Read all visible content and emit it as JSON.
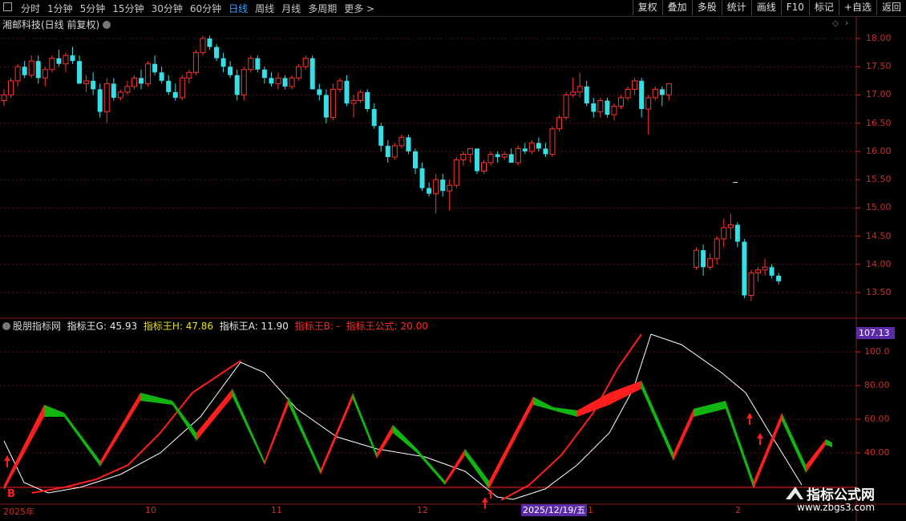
{
  "toolbar": {
    "periods": [
      "分时",
      "1分钟",
      "5分钟",
      "15分钟",
      "30分钟",
      "60分钟",
      "日线",
      "周线",
      "月线",
      "多周期",
      "更多 >"
    ],
    "active_period": "日线",
    "buttons": [
      "复权",
      "叠加",
      "多股",
      "统计",
      "画线",
      "F10",
      "标记",
      "+自选",
      "返回"
    ]
  },
  "stock": {
    "title": "湘邮科技(日线 前复权)"
  },
  "price_axis": [
    "18.00",
    "17.50",
    "17.00",
    "16.50",
    "16.00",
    "15.50",
    "15.00",
    "14.50",
    "14.00",
    "13.50"
  ],
  "indicator": {
    "name": "股朋指标网",
    "g": "指标王G: 45.93",
    "h": "指标王H: 47.86",
    "a": "指标王A: 11.90",
    "b": "指标王B: -",
    "formula": "指标王公式: 20.00",
    "badge": "107.13",
    "axis": [
      "100.0",
      "80.00",
      "60.00",
      "40.00"
    ]
  },
  "dates": [
    "2025年",
    "10",
    "11",
    "12",
    "2025/12/19/五",
    "1",
    "2"
  ],
  "marks": {
    "b": "B"
  },
  "watermark": {
    "line1": "指标公式网",
    "line2": "www.zbgs3.com"
  },
  "colors": {
    "up": "#ff3232",
    "down": "#34e0e6",
    "green": "#11b411",
    "red": "#ff1e1e",
    "white": "#ffffff"
  },
  "chart_data": {
    "type": "candlestick",
    "ylim": [
      13.3,
      18.2
    ],
    "candles": [
      [
        16.9,
        17.1,
        16.8,
        17.0
      ],
      [
        17.0,
        17.3,
        16.95,
        17.25
      ],
      [
        17.25,
        17.55,
        17.15,
        17.5
      ],
      [
        17.5,
        17.6,
        17.3,
        17.35
      ],
      [
        17.35,
        17.7,
        17.3,
        17.6
      ],
      [
        17.6,
        17.7,
        17.2,
        17.3
      ],
      [
        17.3,
        17.5,
        17.15,
        17.45
      ],
      [
        17.45,
        17.7,
        17.4,
        17.65
      ],
      [
        17.65,
        17.8,
        17.5,
        17.55
      ],
      [
        17.55,
        17.75,
        17.4,
        17.7
      ],
      [
        17.7,
        17.85,
        17.55,
        17.6
      ],
      [
        17.6,
        17.7,
        17.2,
        17.2
      ],
      [
        17.2,
        17.35,
        17.05,
        17.25
      ],
      [
        17.25,
        17.4,
        17.0,
        17.1
      ],
      [
        17.1,
        17.2,
        16.6,
        16.7
      ],
      [
        16.7,
        17.3,
        16.5,
        17.2
      ],
      [
        17.2,
        17.3,
        16.9,
        16.95
      ],
      [
        16.95,
        17.1,
        16.9,
        17.05
      ],
      [
        17.05,
        17.25,
        17.0,
        17.15
      ],
      [
        17.15,
        17.35,
        17.1,
        17.3
      ],
      [
        17.3,
        17.45,
        17.1,
        17.2
      ],
      [
        17.2,
        17.6,
        17.15,
        17.55
      ],
      [
        17.55,
        17.7,
        17.35,
        17.4
      ],
      [
        17.4,
        17.5,
        17.2,
        17.25
      ],
      [
        17.25,
        17.35,
        17.0,
        17.05
      ],
      [
        17.05,
        17.2,
        16.9,
        16.95
      ],
      [
        16.95,
        17.35,
        16.9,
        17.3
      ],
      [
        17.3,
        17.45,
        17.2,
        17.4
      ],
      [
        17.4,
        17.8,
        17.35,
        17.75
      ],
      [
        17.75,
        18.05,
        17.7,
        18.0
      ],
      [
        18.0,
        18.05,
        17.8,
        17.85
      ],
      [
        17.85,
        17.9,
        17.6,
        17.65
      ],
      [
        17.65,
        17.75,
        17.4,
        17.5
      ],
      [
        17.5,
        17.6,
        17.3,
        17.35
      ],
      [
        17.35,
        17.45,
        16.9,
        17.0
      ],
      [
        17.0,
        17.5,
        16.9,
        17.45
      ],
      [
        17.45,
        17.7,
        17.4,
        17.65
      ],
      [
        17.65,
        17.7,
        17.4,
        17.45
      ],
      [
        17.45,
        17.5,
        17.2,
        17.3
      ],
      [
        17.3,
        17.4,
        17.15,
        17.2
      ],
      [
        17.2,
        17.4,
        17.1,
        17.3
      ],
      [
        17.3,
        17.35,
        17.1,
        17.15
      ],
      [
        17.15,
        17.35,
        17.1,
        17.3
      ],
      [
        17.3,
        17.55,
        17.25,
        17.5
      ],
      [
        17.5,
        17.7,
        17.45,
        17.65
      ],
      [
        17.65,
        17.7,
        17.1,
        17.1
      ],
      [
        17.1,
        17.2,
        16.9,
        17.0
      ],
      [
        17.0,
        17.1,
        16.5,
        16.6
      ],
      [
        16.6,
        17.2,
        16.55,
        17.1
      ],
      [
        17.1,
        17.3,
        17.05,
        17.25
      ],
      [
        17.25,
        17.35,
        16.8,
        16.85
      ],
      [
        16.85,
        17.0,
        16.6,
        16.9
      ],
      [
        16.9,
        17.1,
        16.85,
        17.05
      ],
      [
        17.05,
        17.1,
        16.7,
        16.75
      ],
      [
        16.75,
        16.85,
        16.4,
        16.45
      ],
      [
        16.45,
        16.5,
        16.0,
        16.1
      ],
      [
        16.1,
        16.2,
        15.8,
        15.9
      ],
      [
        15.9,
        16.15,
        15.85,
        16.1
      ],
      [
        16.1,
        16.3,
        16.05,
        16.25
      ],
      [
        16.25,
        16.3,
        15.95,
        16.0
      ],
      [
        16.0,
        16.05,
        15.6,
        15.7
      ],
      [
        15.7,
        15.8,
        15.3,
        15.35
      ],
      [
        15.35,
        15.45,
        15.2,
        15.25
      ],
      [
        15.25,
        15.6,
        14.9,
        15.5
      ],
      [
        15.5,
        15.6,
        15.2,
        15.3
      ],
      [
        15.3,
        15.5,
        14.95,
        15.4
      ],
      [
        15.4,
        15.9,
        15.35,
        15.85
      ],
      [
        15.85,
        16.0,
        15.75,
        15.95
      ],
      [
        15.95,
        16.05,
        15.8,
        16.05
      ],
      [
        16.05,
        16.05,
        15.6,
        15.65
      ],
      [
        15.65,
        15.85,
        15.6,
        15.8
      ],
      [
        15.8,
        16.0,
        15.75,
        15.95
      ],
      [
        15.95,
        16.0,
        15.8,
        15.9
      ],
      [
        15.9,
        16.0,
        15.85,
        15.95
      ],
      [
        15.95,
        16.05,
        15.8,
        15.8
      ],
      [
        15.8,
        16.1,
        15.75,
        16.05
      ],
      [
        16.05,
        16.15,
        15.95,
        16.0
      ],
      [
        16.0,
        16.2,
        15.95,
        16.15
      ],
      [
        16.15,
        16.25,
        16.0,
        16.05
      ],
      [
        16.05,
        16.15,
        15.9,
        15.95
      ],
      [
        15.95,
        16.45,
        15.9,
        16.4
      ],
      [
        16.4,
        16.65,
        16.35,
        16.6
      ],
      [
        16.6,
        17.05,
        16.55,
        17.0
      ],
      [
        17.0,
        17.3,
        16.95,
        17.05
      ],
      [
        17.05,
        17.4,
        16.95,
        17.15
      ],
      [
        17.15,
        17.25,
        16.8,
        16.85
      ],
      [
        16.85,
        16.95,
        16.6,
        16.7
      ],
      [
        16.7,
        16.95,
        16.6,
        16.9
      ],
      [
        16.9,
        16.95,
        16.6,
        16.65
      ],
      [
        16.65,
        16.85,
        16.55,
        16.8
      ],
      [
        16.8,
        17.0,
        16.75,
        16.95
      ],
      [
        16.95,
        17.15,
        16.9,
        17.1
      ],
      [
        17.1,
        17.3,
        17.0,
        17.25
      ],
      [
        17.25,
        17.3,
        16.6,
        16.75
      ],
      [
        16.75,
        17.0,
        16.3,
        16.95
      ],
      [
        16.95,
        17.15,
        16.9,
        17.1
      ],
      [
        17.1,
        17.15,
        16.8,
        17.0
      ],
      [
        17.0,
        17.2,
        16.9,
        17.2
      ],
      null,
      null,
      null,
      [
        13.95,
        14.3,
        13.9,
        14.25
      ],
      [
        14.25,
        14.35,
        13.8,
        13.95
      ],
      [
        13.95,
        14.2,
        13.9,
        14.1
      ],
      [
        14.1,
        14.5,
        14.0,
        14.45
      ],
      [
        14.45,
        14.8,
        14.3,
        14.65
      ],
      [
        14.65,
        14.9,
        14.45,
        14.7
      ],
      [
        14.7,
        14.75,
        14.3,
        14.4
      ],
      [
        14.4,
        14.45,
        13.4,
        13.45
      ],
      [
        13.45,
        13.9,
        13.35,
        13.85
      ],
      [
        13.85,
        13.95,
        13.7,
        13.9
      ],
      [
        13.9,
        14.1,
        13.8,
        13.95
      ],
      [
        13.95,
        14.0,
        13.75,
        13.8
      ],
      [
        13.8,
        13.85,
        13.65,
        13.7
      ]
    ]
  }
}
